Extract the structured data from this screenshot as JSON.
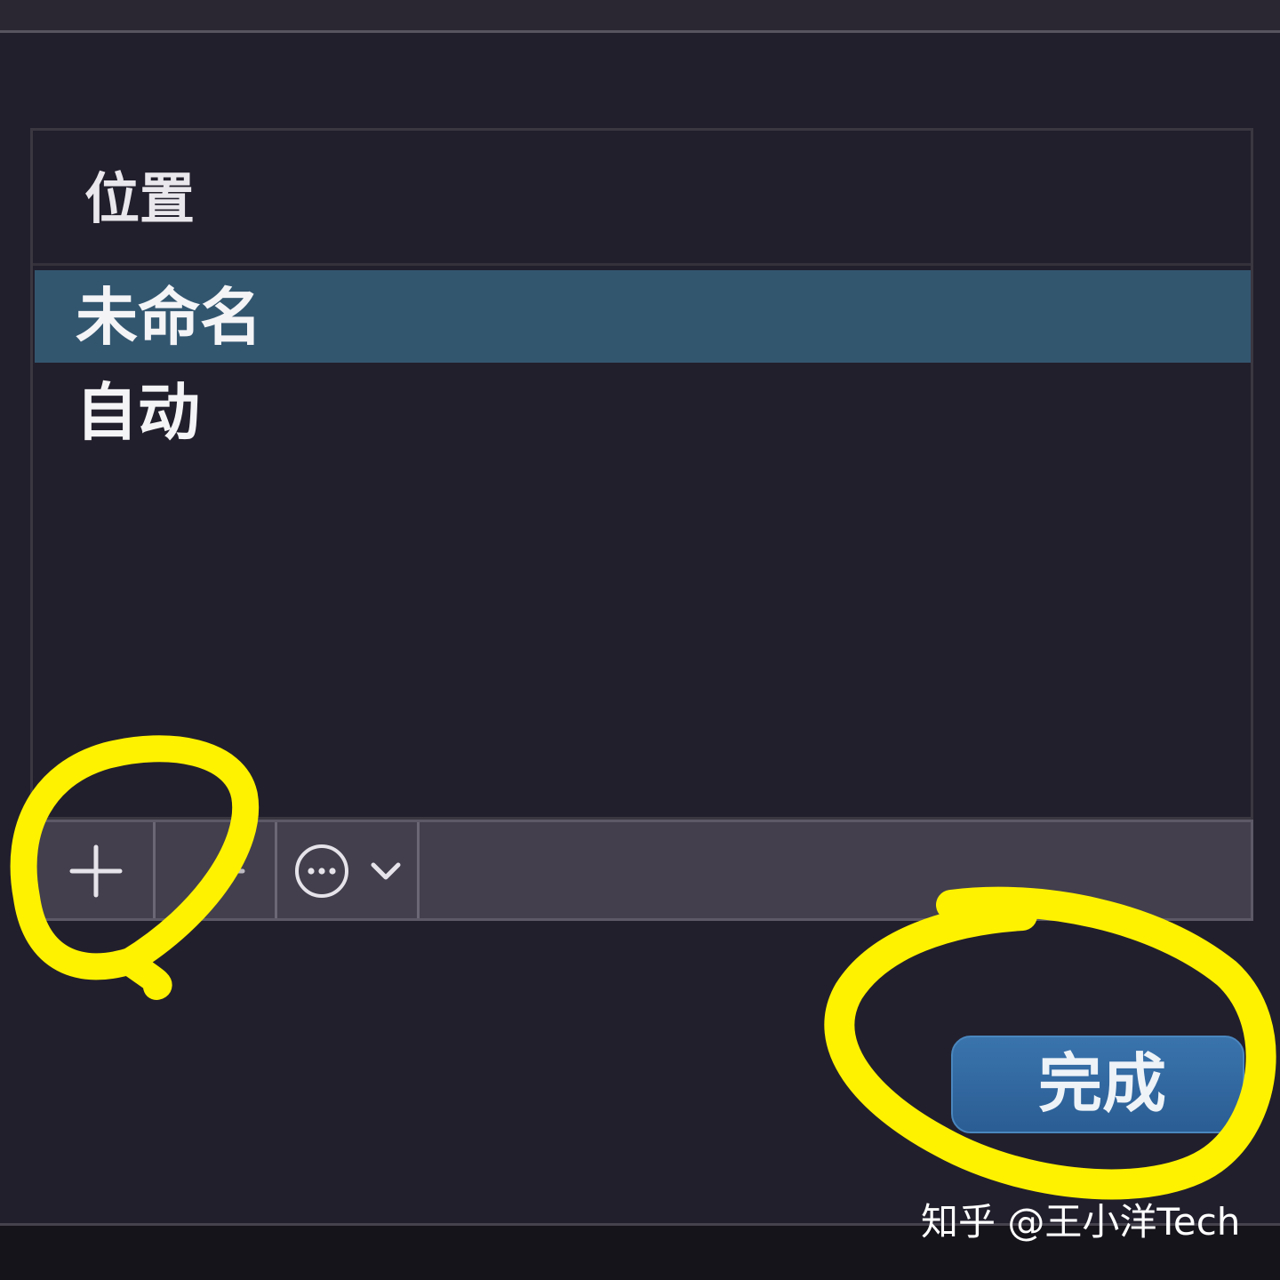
{
  "list": {
    "header_label": "位置",
    "items": [
      {
        "label": "未命名",
        "selected": true
      },
      {
        "label": "自动",
        "selected": false
      }
    ]
  },
  "toolbar": {
    "add_icon": "plus-icon",
    "remove_icon": "minus-icon",
    "more_icon": "ellipsis-circle-icon",
    "dropdown_icon": "chevron-down-icon"
  },
  "footer": {
    "done_label": "完成"
  },
  "watermark": {
    "text": "知乎 @王小洋Tech"
  },
  "colors": {
    "background": "#221f2c",
    "selection": "#33566f",
    "toolbar": "#433f4d",
    "done_button": "#2f6aa4",
    "highlight_marker": "#fff200"
  }
}
